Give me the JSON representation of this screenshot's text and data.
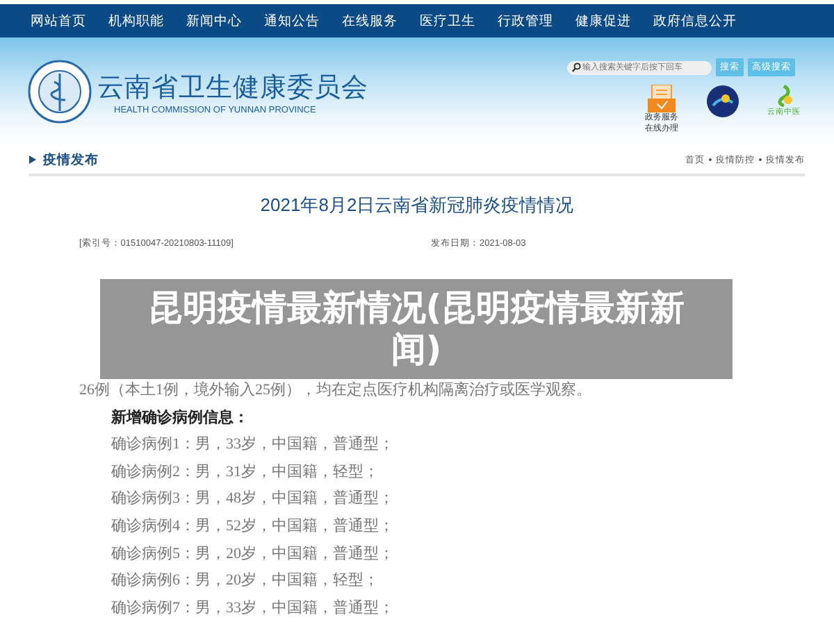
{
  "nav": [
    "网站首页",
    "机构职能",
    "新闻中心",
    "通知公告",
    "在线服务",
    "医疗卫生",
    "行政管理",
    "健康促进",
    "政府信息公开"
  ],
  "header": {
    "title": "云南省卫生健康委员会",
    "subtitle": "HEALTH COMMISSION OF YUNNAN PROVINCE",
    "search": {
      "placeholder": "输入搜索关键字后按下回车"
    },
    "buttons": [
      "搜索",
      "高级搜索"
    ],
    "service_label": [
      "政务服务",
      "在线办理"
    ],
    "badge_label": "云南中医"
  },
  "section": {
    "title": "疫情发布",
    "breadcrumb": [
      "首页",
      "疫情防控",
      "疫情发布"
    ]
  },
  "article": {
    "title": "2021年8月2日云南省新冠肺炎疫情情况",
    "index_no": "[索引号：01510047-20210803-11109]",
    "date": "发布日期：2021-08-03",
    "lines": [
      {
        "kind": "plain",
        "text": "26例（本土1例，境外输入25例），均在定点医疗机构隔离治疗或医学观察。"
      },
      {
        "kind": "heading",
        "text": "新增确诊病例信息："
      },
      {
        "kind": "indent",
        "text": "确诊病例1：男，33岁，中国籍，普通型；"
      },
      {
        "kind": "indent",
        "text": "确诊病例2：男，31岁，中国籍，轻型；"
      },
      {
        "kind": "indent",
        "text": "确诊病例3：男，48岁，中国籍，普通型；"
      },
      {
        "kind": "indent",
        "text": "确诊病例4：男，52岁，中国籍，普通型；"
      },
      {
        "kind": "indent",
        "text": "确诊病例5：男，20岁，中国籍，普通型；"
      },
      {
        "kind": "indent",
        "text": "确诊病例6：男，20岁，中国籍，轻型；"
      },
      {
        "kind": "indent",
        "text": "确诊病例7：男，33岁，中国籍，普通型；"
      }
    ]
  },
  "overlay": {
    "title": "昆明疫情最新情况(昆明疫情最新新闻)"
  }
}
